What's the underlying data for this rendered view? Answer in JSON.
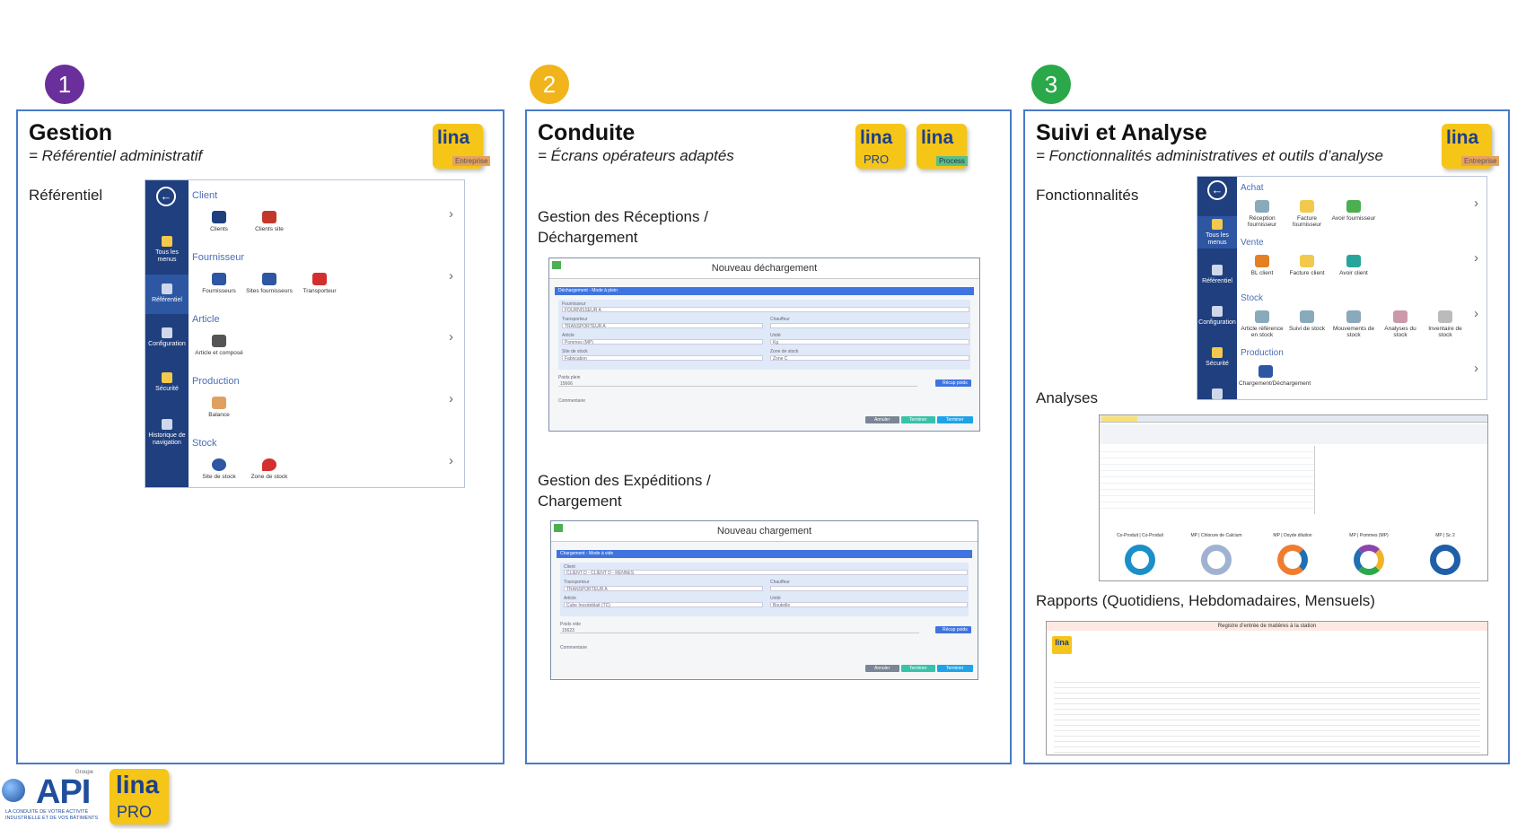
{
  "steps": [
    {
      "num": "1",
      "color": "#6a2f9a",
      "title": "Gestion",
      "subtitle": "= Référentiel administratif"
    },
    {
      "num": "2",
      "color": "#f1b41a",
      "title": "Conduite",
      "subtitle": "= Écrans opérateurs adaptés"
    },
    {
      "num": "3",
      "color": "#2aa84a",
      "title": "Suivi et Analyse",
      "subtitle": "= Fonctionnalités administratives et outils d’analyse"
    }
  ],
  "logos": {
    "lina": "lina",
    "entreprise": "Entreprise",
    "pro": "PRO",
    "process": "Process",
    "api": "API",
    "groupe": "Groupe",
    "tagline1": "LA CONDUITE DE VOTRE ACTIVITÉ",
    "tagline2": "INDUSTRIELLE ET DE VOS BÂTIMENTS"
  },
  "gestion": {
    "label": "Référentiel",
    "sidebar": [
      {
        "label": "Tous les menus"
      },
      {
        "label": "Référentiel"
      },
      {
        "label": "Configuration"
      },
      {
        "label": "Sécurité"
      },
      {
        "label": "Historique de navigation"
      }
    ],
    "sections": [
      {
        "title": "Client",
        "items": [
          "Clients",
          "Clients site"
        ]
      },
      {
        "title": "Fournisseur",
        "items": [
          "Fournisseurs",
          "Sites fournisseurs",
          "Transporteur"
        ]
      },
      {
        "title": "Article",
        "items": [
          "Article et composé"
        ]
      },
      {
        "title": "Production",
        "items": [
          "Balance"
        ]
      },
      {
        "title": "Stock",
        "items": [
          "Site de stock",
          "Zone de stock"
        ]
      }
    ]
  },
  "conduite": {
    "reception_label": "Gestion des Réceptions / Déchargement",
    "expedition_label": "Gestion des Expéditions / Chargement",
    "screen1": {
      "title": "Nouveau déchargement",
      "bar": "Déchargement - Mode à plein",
      "fields": [
        "Fournisseur",
        "FOURNISSEUR A",
        "Transporteur",
        "TRANSPORTEUR A",
        "Chauffeur",
        "Article",
        "Pommes (MP)",
        "Unité",
        "Kg",
        "Site de stock",
        "Fabrication",
        "Zone de stock",
        "Zone C",
        "Poids plein",
        "15666",
        "Commentaire",
        "Récup poids"
      ],
      "buttons": [
        "Annuler",
        "Terminer",
        "Terminer"
      ]
    },
    "screen2": {
      "title": "Nouveau chargement",
      "bar": "Chargement - Mode à vide",
      "fields": [
        "Client",
        "CLIENT D - CLIENT D - RENNES",
        "Transporteur",
        "TRANSPORTEUR A",
        "Chauffeur",
        "Article",
        "Cube Inoxdeblait (TC)",
        "Unité",
        "Bouteille",
        "Poids vide",
        "15623",
        "Commentaire",
        "Récup poids"
      ],
      "buttons": [
        "Annuler",
        "Terminer",
        "Terminer"
      ]
    }
  },
  "suivi": {
    "fonctions_label": "Fonctionnalités",
    "analyses_label": "Analyses",
    "rapports_label": "Rapports (Quotidiens, Hebdomadaires, Mensuels)",
    "sidebar": [
      {
        "label": "Tous les menus"
      },
      {
        "label": "Référentiel"
      },
      {
        "label": "Configuration"
      },
      {
        "label": "Sécurité"
      }
    ],
    "sections": [
      {
        "title": "Achat",
        "items": [
          "Réception fournisseur",
          "Facture fournisseur",
          "Avoir fournisseur"
        ]
      },
      {
        "title": "Vente",
        "items": [
          "BL client",
          "Facture client",
          "Avoir client"
        ]
      },
      {
        "title": "Stock",
        "items": [
          "Article référence en stock",
          "Suivi de stock",
          "Mouvements de stock",
          "Analyses du stock",
          "Inventaire de stock"
        ]
      },
      {
        "title": "Production",
        "items": [
          "Chargement/Déchargement"
        ]
      }
    ],
    "donuts": [
      "Co-Produit | Co-Produit",
      "MP | Chlorure de Calcium",
      "MP | Oxyde dilution",
      "MP | Pommes (MP)",
      "MP | Sc 2"
    ],
    "report_title": "Registre d’entrée de matières à la station"
  },
  "colors": {
    "accent": "#4a7ac7",
    "sidebar": "#1f3f7e",
    "bar": "#3f74e0"
  }
}
